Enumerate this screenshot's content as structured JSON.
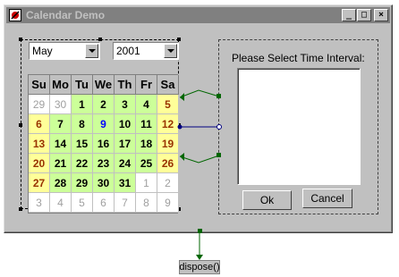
{
  "window": {
    "title": "Calendar Demo",
    "minimize_label": "_",
    "maximize_label": "□",
    "close_label": "×"
  },
  "calendar": {
    "month": "May",
    "year": "2001",
    "headers": [
      "Su",
      "Mo",
      "Tu",
      "We",
      "Th",
      "Fr",
      "Sa"
    ],
    "weeks": [
      [
        {
          "d": "29",
          "t": "other"
        },
        {
          "d": "30",
          "t": "other"
        },
        {
          "d": "1",
          "t": "weekday"
        },
        {
          "d": "2",
          "t": "weekday"
        },
        {
          "d": "3",
          "t": "weekday"
        },
        {
          "d": "4",
          "t": "weekday"
        },
        {
          "d": "5",
          "t": "weekend"
        }
      ],
      [
        {
          "d": "6",
          "t": "weekend"
        },
        {
          "d": "7",
          "t": "weekday"
        },
        {
          "d": "8",
          "t": "weekday"
        },
        {
          "d": "9",
          "t": "weekday today"
        },
        {
          "d": "10",
          "t": "weekday"
        },
        {
          "d": "11",
          "t": "weekday"
        },
        {
          "d": "12",
          "t": "weekend"
        }
      ],
      [
        {
          "d": "13",
          "t": "weekend"
        },
        {
          "d": "14",
          "t": "weekday"
        },
        {
          "d": "15",
          "t": "weekday"
        },
        {
          "d": "16",
          "t": "weekday"
        },
        {
          "d": "17",
          "t": "weekday"
        },
        {
          "d": "18",
          "t": "weekday"
        },
        {
          "d": "19",
          "t": "weekend"
        }
      ],
      [
        {
          "d": "20",
          "t": "weekend"
        },
        {
          "d": "21",
          "t": "weekday"
        },
        {
          "d": "22",
          "t": "weekday"
        },
        {
          "d": "23",
          "t": "weekday"
        },
        {
          "d": "24",
          "t": "weekday"
        },
        {
          "d": "25",
          "t": "weekday"
        },
        {
          "d": "26",
          "t": "weekend"
        }
      ],
      [
        {
          "d": "27",
          "t": "weekend"
        },
        {
          "d": "28",
          "t": "weekday"
        },
        {
          "d": "29",
          "t": "weekday"
        },
        {
          "d": "30",
          "t": "weekday"
        },
        {
          "d": "31",
          "t": "weekday"
        },
        {
          "d": "1",
          "t": "other"
        },
        {
          "d": "2",
          "t": "other"
        }
      ],
      [
        {
          "d": "3",
          "t": "other"
        },
        {
          "d": "4",
          "t": "other"
        },
        {
          "d": "5",
          "t": "other"
        },
        {
          "d": "6",
          "t": "other"
        },
        {
          "d": "7",
          "t": "other"
        },
        {
          "d": "8",
          "t": "other"
        },
        {
          "d": "9",
          "t": "other"
        }
      ]
    ]
  },
  "panel": {
    "label": "Please Select Time Interval:",
    "ok_label": "Ok",
    "cancel_label": "Cancel"
  },
  "dispose_label": "dispose()",
  "colors": {
    "weekday": "#ccff99",
    "weekend": "#ffff99",
    "wire_green": "#006600",
    "wire_navy": "#000080"
  }
}
